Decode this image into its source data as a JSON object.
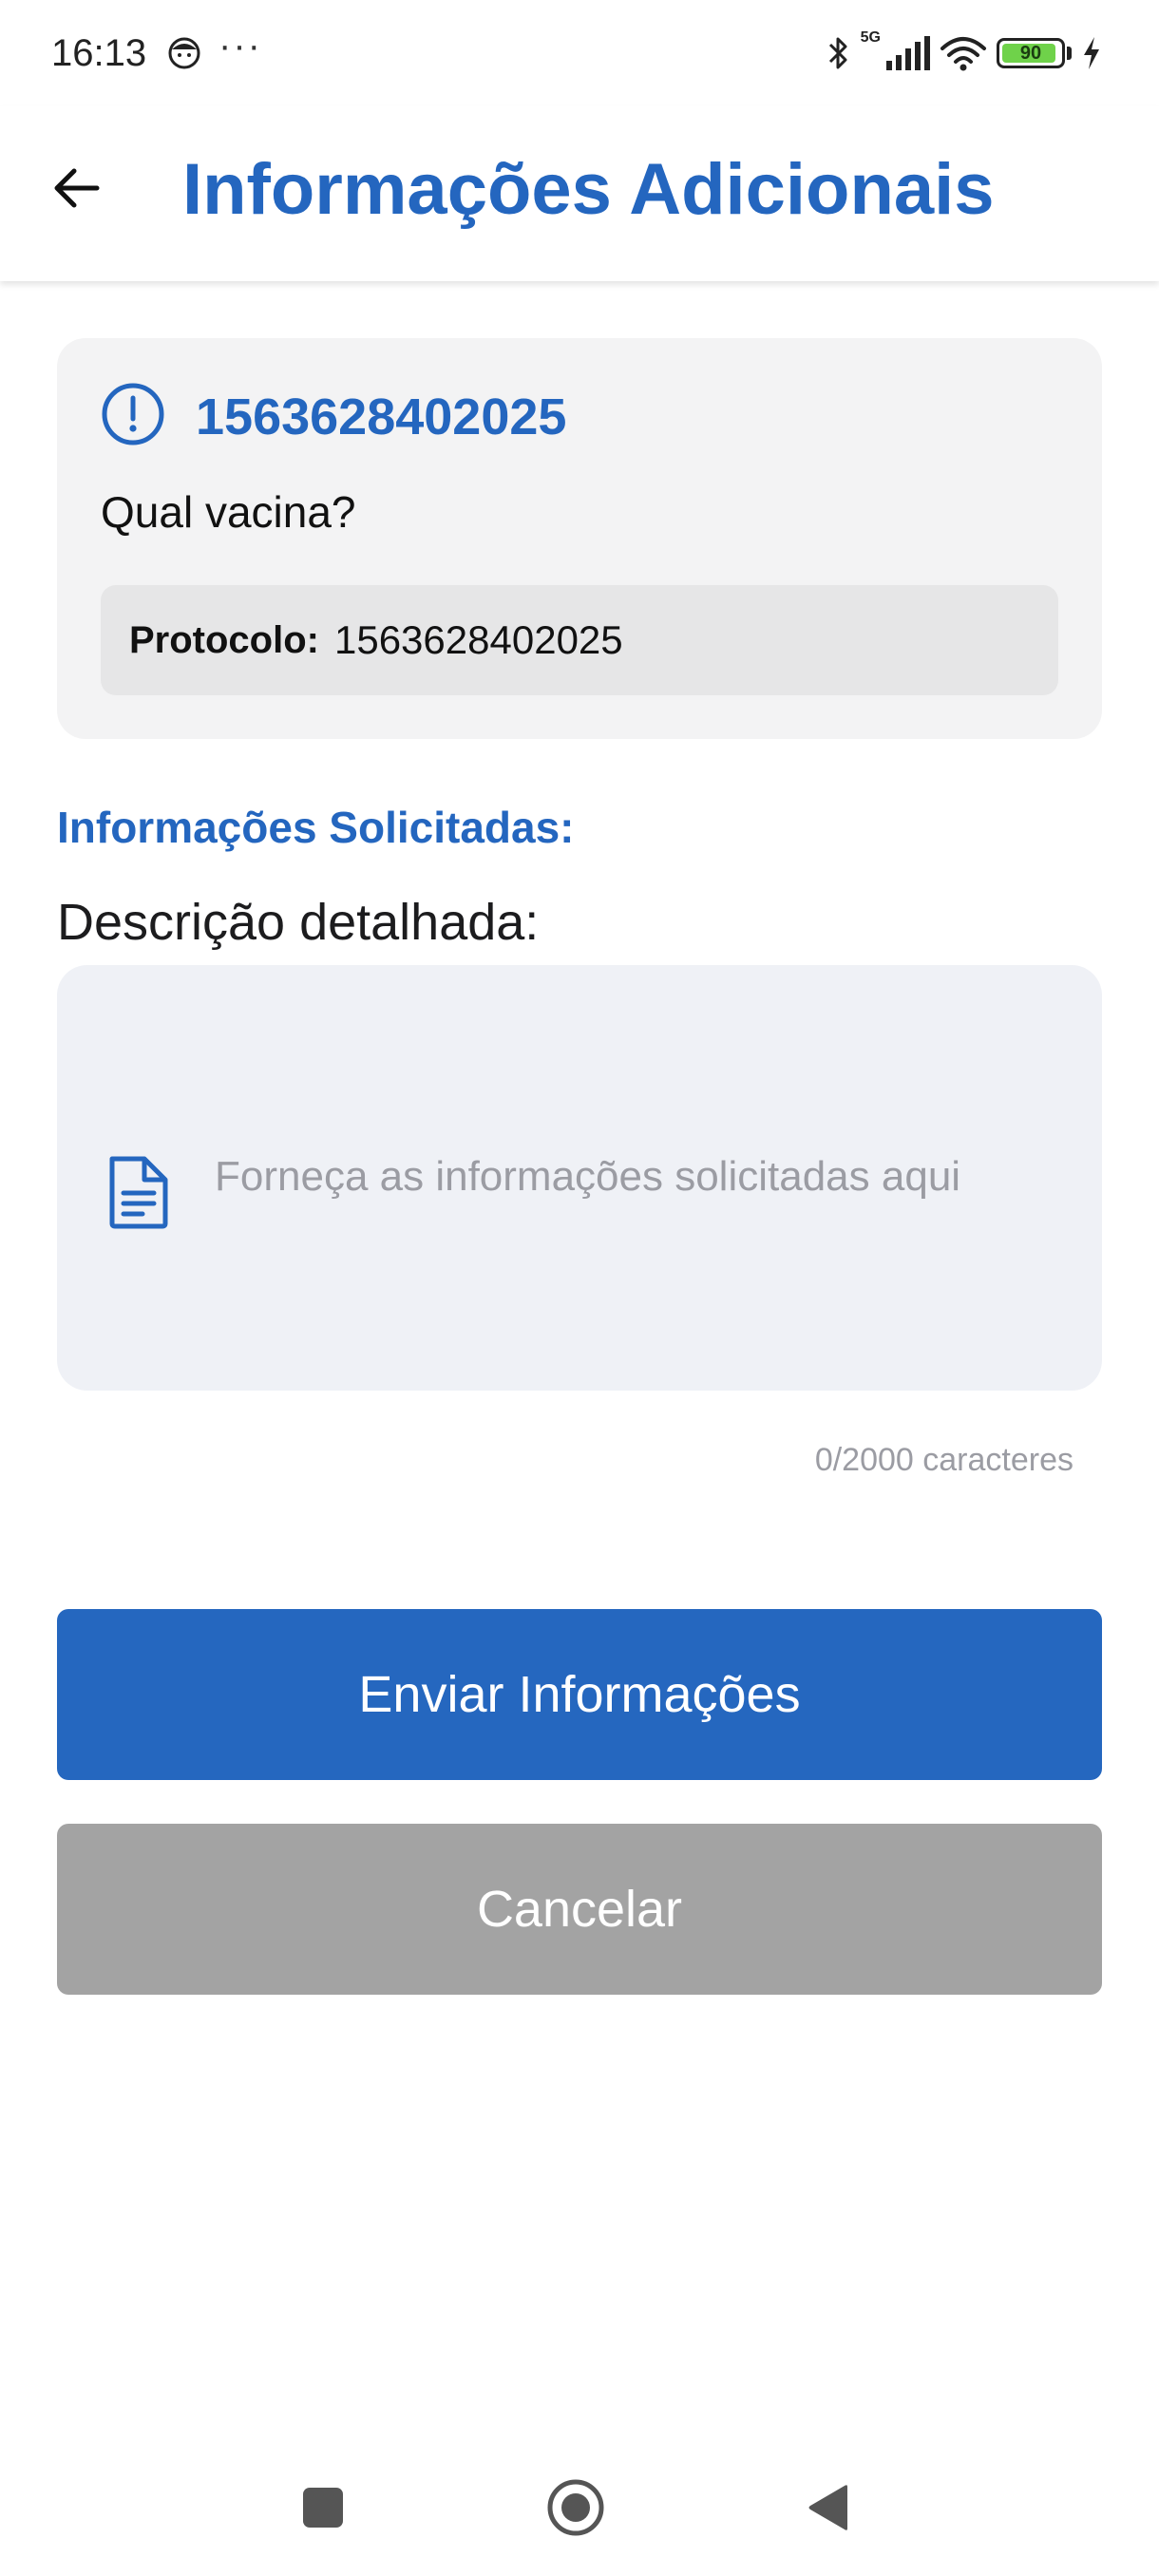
{
  "status_bar": {
    "time": "16:13",
    "more": "···",
    "network": "5G",
    "battery_level": "90"
  },
  "header": {
    "title": "Informações Adicionais",
    "back_icon": "arrow-left-icon"
  },
  "info_card": {
    "protocol_title": "1563628402025",
    "question": "Qual vacina?",
    "protocol_label": "Protocolo:",
    "protocol_value": "1563628402025",
    "icon": "alert-circle-icon"
  },
  "form": {
    "section_title": "Informações Solicitadas:",
    "field_label": "Descrição detalhada:",
    "placeholder": "Forneça as informações solicitadas aqui",
    "value": "",
    "char_counter": "0/2000 caracteres",
    "icon": "document-icon"
  },
  "actions": {
    "send_label": "Enviar Informações",
    "cancel_label": "Cancelar"
  },
  "colors": {
    "primary": "#2466bf",
    "cancel": "#a3a3a3",
    "card_background": "#f3f3f4",
    "input_background": "#eff1f6"
  }
}
